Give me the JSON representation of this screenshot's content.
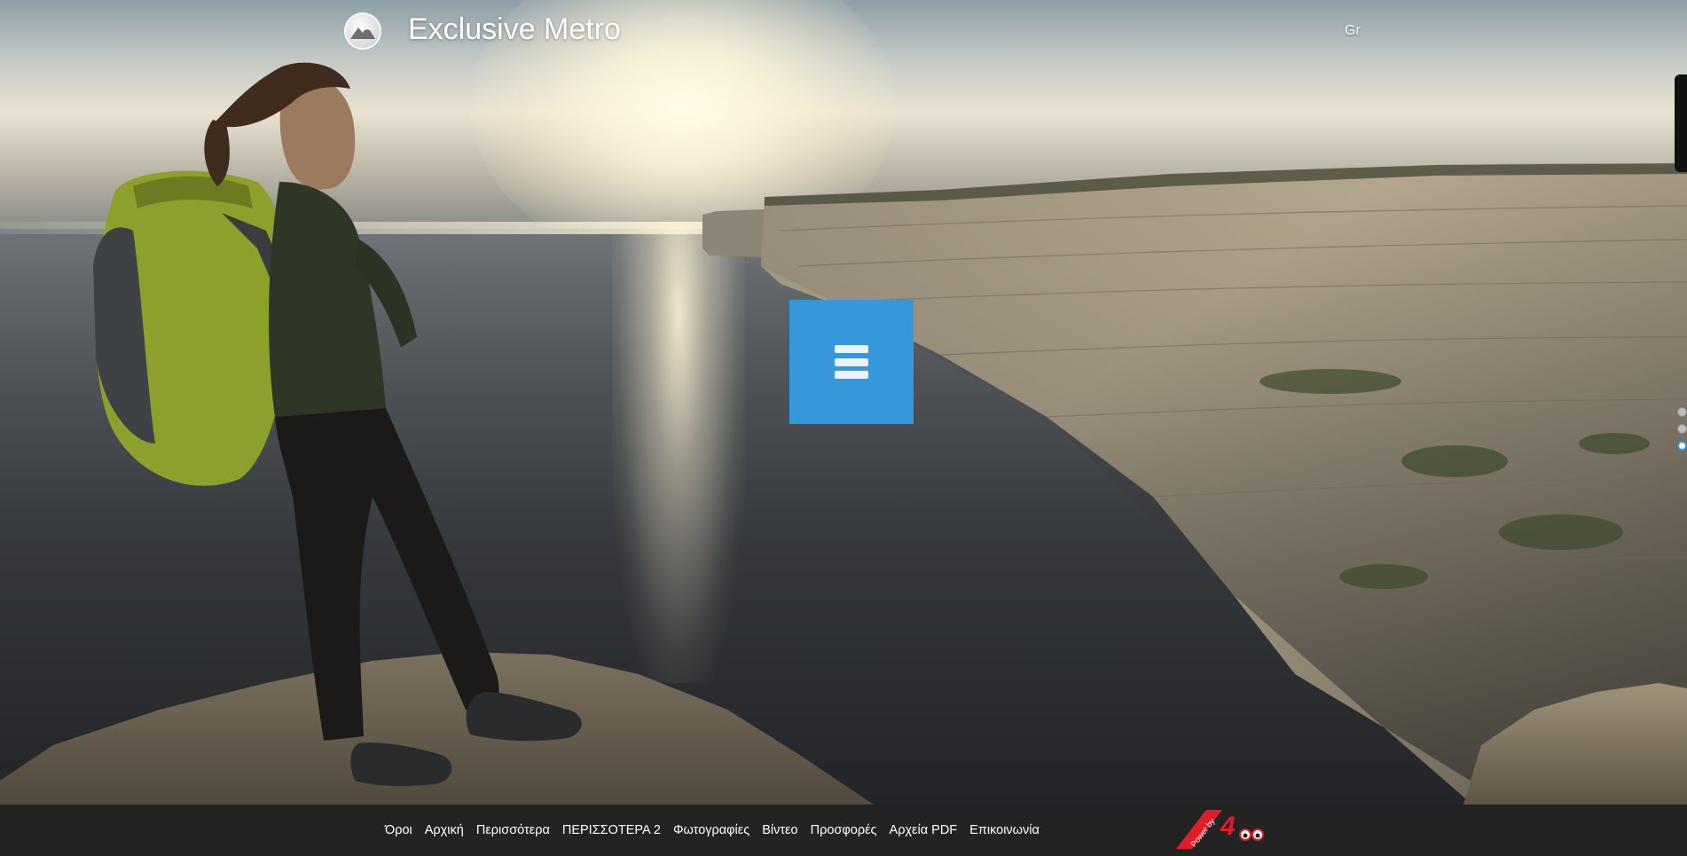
{
  "header": {
    "title": "Exclusive Metro",
    "language": "Gr"
  },
  "menu_button": {
    "icon": "hamburger-menu-icon"
  },
  "slider": {
    "dots_count": 3,
    "active_index": 2
  },
  "footer": {
    "nav": [
      "Όροι",
      "Αρχική",
      "Περισσότερα",
      "ΠΕΡΙΣΣΟΤΕΡΑ 2",
      "Φωτογραφίες",
      "Βίντεο",
      "Προσφορές",
      "Αρχεία PDF",
      "Επικοινωνία"
    ],
    "badge": {
      "text": "Power by",
      "brand": "4"
    }
  },
  "colors": {
    "accent": "#3498db",
    "footer_bg": "#232323",
    "badge_red": "#e21d2b"
  }
}
